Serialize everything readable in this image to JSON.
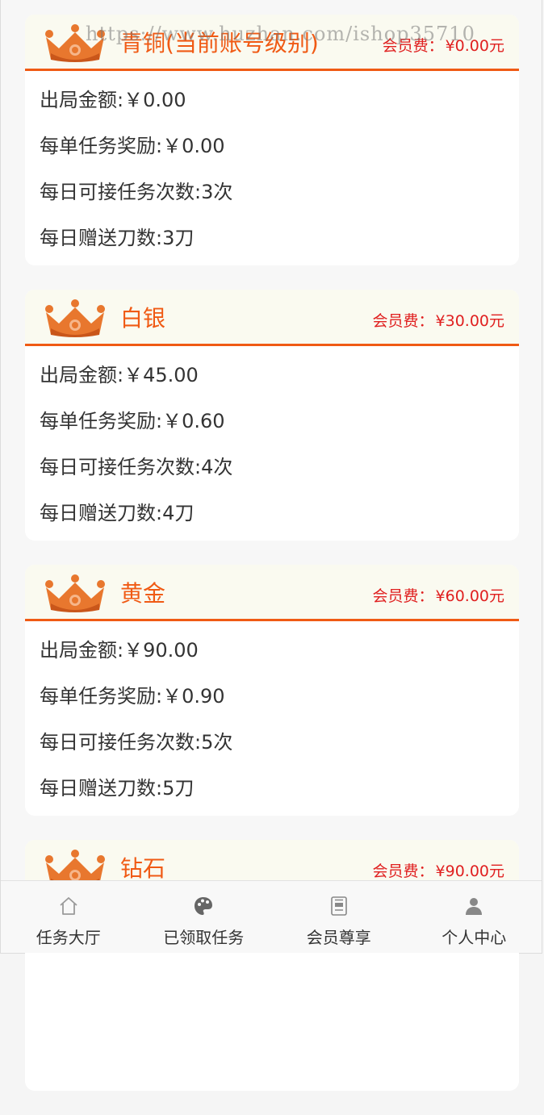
{
  "watermark": "https://www.huzhan.com/ishop35710",
  "fee_label": "会员费：",
  "levels": [
    {
      "name": "青铜(当前账号级别)",
      "fee": "¥0.00元",
      "rows": [
        "出局金额:￥0.00",
        "每单任务奖励:￥0.00",
        "每日可接任务次数:3次",
        "每日赠送刀数:3刀"
      ]
    },
    {
      "name": "白银",
      "fee": "¥30.00元",
      "rows": [
        "出局金额:￥45.00",
        "每单任务奖励:￥0.60",
        "每日可接任务次数:4次",
        "每日赠送刀数:4刀"
      ]
    },
    {
      "name": "黄金",
      "fee": "¥60.00元",
      "rows": [
        "出局金额:￥90.00",
        "每单任务奖励:￥0.90",
        "每日可接任务次数:5次",
        "每日赠送刀数:5刀"
      ]
    },
    {
      "name": "钻石",
      "fee": "¥90.00元",
      "rows": []
    }
  ],
  "tabs": [
    {
      "label": "任务大厅",
      "icon": "home-icon"
    },
    {
      "label": "已领取任务",
      "icon": "palette-icon"
    },
    {
      "label": "会员尊享",
      "icon": "member-card-icon"
    },
    {
      "label": "个人中心",
      "icon": "user-icon"
    }
  ],
  "colors": {
    "accent": "#f05a14",
    "fee": "#e02020",
    "crown": "#e8772e"
  }
}
